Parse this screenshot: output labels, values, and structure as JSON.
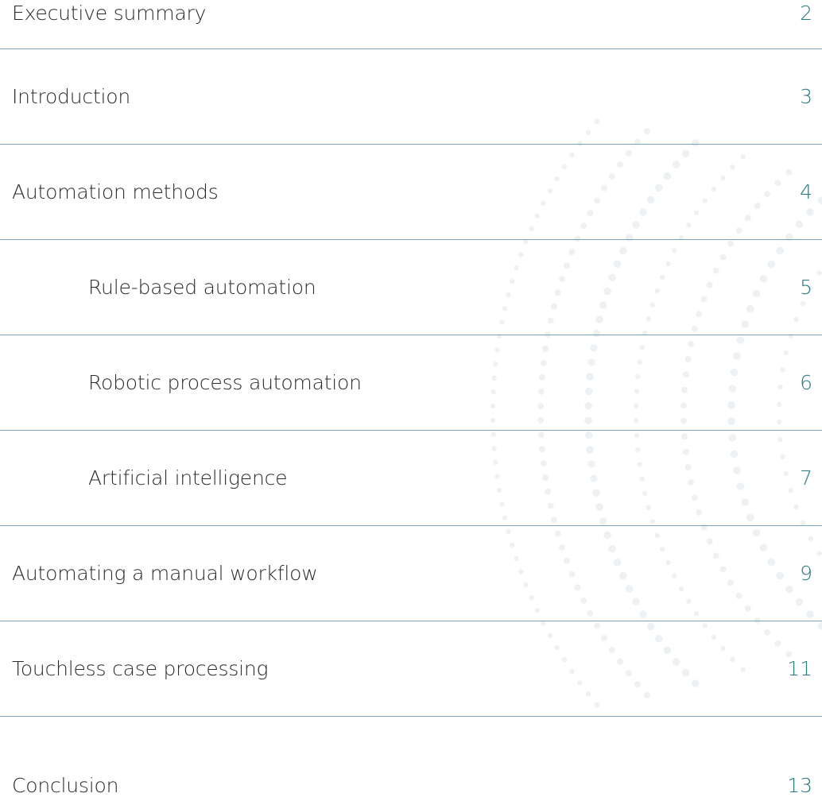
{
  "toc": {
    "entries": [
      {
        "title": "Executive summary",
        "page": "2",
        "level": 1
      },
      {
        "title": "Introduction",
        "page": "3",
        "level": 1
      },
      {
        "title": "Automation methods",
        "page": "4",
        "level": 1
      },
      {
        "title": "Rule-based automation",
        "page": "5",
        "level": 2
      },
      {
        "title": "Robotic process automation",
        "page": "6",
        "level": 2
      },
      {
        "title": "Artificial intelligence",
        "page": "7",
        "level": 2
      },
      {
        "title": "Automating a manual workflow",
        "page": "9",
        "level": 1
      },
      {
        "title": "Touchless case processing",
        "page": "11",
        "level": 1
      },
      {
        "title": "Conclusion",
        "page": "13",
        "level": 1
      }
    ]
  },
  "colors": {
    "rule": "#7e9fb4",
    "page_number": "#2b7a82",
    "text": "#2b2b2b",
    "dot_pattern": "#eef1f4"
  },
  "decor": {
    "background": "dot-pattern"
  }
}
